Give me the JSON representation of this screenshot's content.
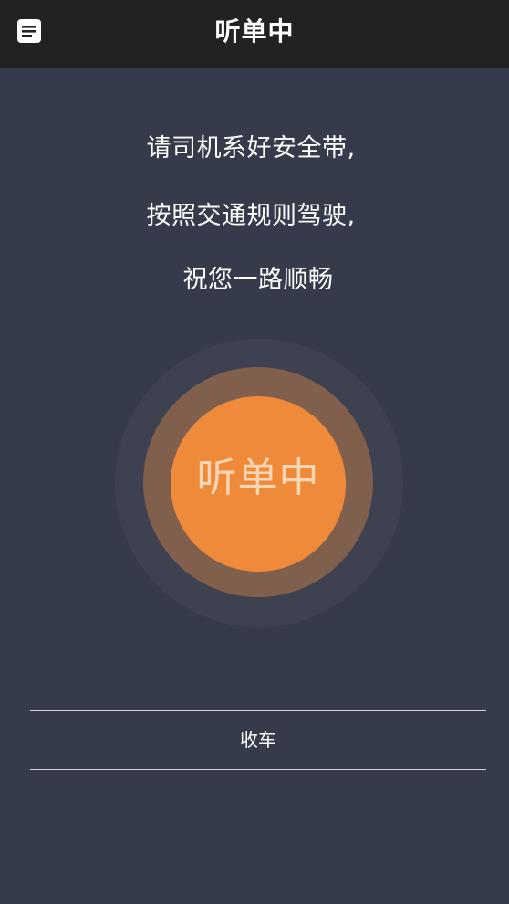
{
  "header": {
    "title": "听单中",
    "menu_icon": "list-document-icon"
  },
  "message": {
    "line1": "请司机系好安全带,",
    "line2": "按照交通规则驾驶,",
    "line3": "祝您一路顺畅"
  },
  "status_button": {
    "label": "听单中"
  },
  "actions": {
    "stop_label": "收车"
  },
  "colors": {
    "background": "#363B4C",
    "topbar": "#222222",
    "accent": "#EF8A3A",
    "ring_mid": "#805F4C",
    "ring_outer": "#3E4250"
  }
}
